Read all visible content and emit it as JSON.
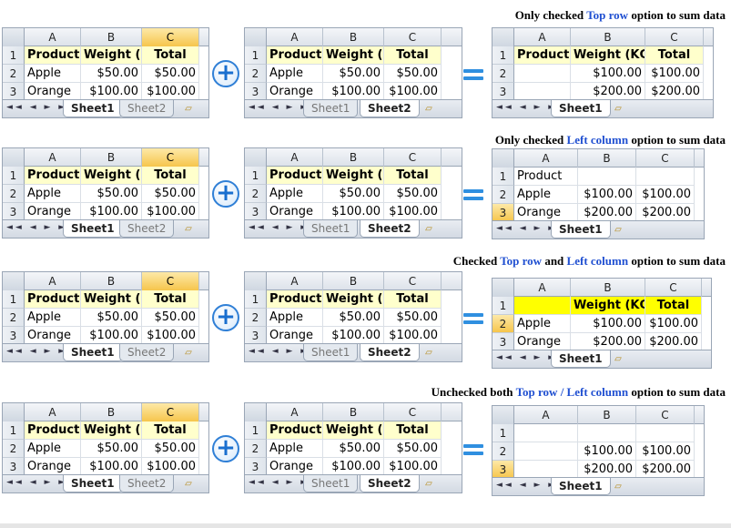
{
  "captions": [
    {
      "pre": "Only checked ",
      "hl1": "Top row",
      "mid": " option to sum data",
      "hl2": "",
      "post": ""
    },
    {
      "pre": "Only checked ",
      "hl1": "Left column",
      "mid": " option to sum data",
      "hl2": "",
      "post": ""
    },
    {
      "pre": "Checked ",
      "hl1": "Top row",
      "mid": " and ",
      "hl2": "Left column",
      "post": " option to sum data"
    },
    {
      "pre": "Unchecked both ",
      "hl1": "Top row / Left column",
      "mid": " option to sum data",
      "hl2": "",
      "post": ""
    }
  ],
  "source": {
    "col_headers": [
      "A",
      "B",
      "C"
    ],
    "row_headers": [
      "1",
      "2",
      "3"
    ],
    "rows": [
      [
        "Product",
        "Weight (KG",
        "Total"
      ],
      [
        "Apple",
        "$50.00",
        "$50.00"
      ],
      [
        "Orange",
        "$100.00",
        "$100.00"
      ]
    ],
    "tabs": [
      "Sheet1",
      "Sheet2"
    ],
    "nav": "◄◄ ◄ ► ►►"
  },
  "results": [
    {
      "rows": [
        [
          "Product",
          "Weight (KG)",
          "Total"
        ],
        [
          "",
          "$100.00",
          "$100.00"
        ],
        [
          "",
          "$200.00",
          "$200.00"
        ]
      ],
      "tab": "Sheet1"
    },
    {
      "rows": [
        [
          "Product",
          "",
          ""
        ],
        [
          "Apple",
          "$100.00",
          "$100.00"
        ],
        [
          "Orange",
          "$200.00",
          "$200.00"
        ]
      ],
      "tab": "Sheet1"
    },
    {
      "rows": [
        [
          "",
          "Weight (KG)",
          "Total"
        ],
        [
          "Apple",
          "$100.00",
          "$100.00"
        ],
        [
          "Orange",
          "$200.00",
          "$200.00"
        ]
      ],
      "tab": "Sheet1"
    },
    {
      "rows": [
        [
          "",
          "",
          ""
        ],
        [
          "",
          "$100.00",
          "$100.00"
        ],
        [
          "",
          "$200.00",
          "$200.00"
        ]
      ],
      "tab": "Sheet1"
    }
  ],
  "symbols": {
    "plus": "+",
    "equals": "="
  },
  "colors": {
    "highlight": "#1f4fd1",
    "selected_header": "#f6c54c",
    "header_fill": "#ffffcc",
    "yellow_fill": "#ffff00"
  }
}
